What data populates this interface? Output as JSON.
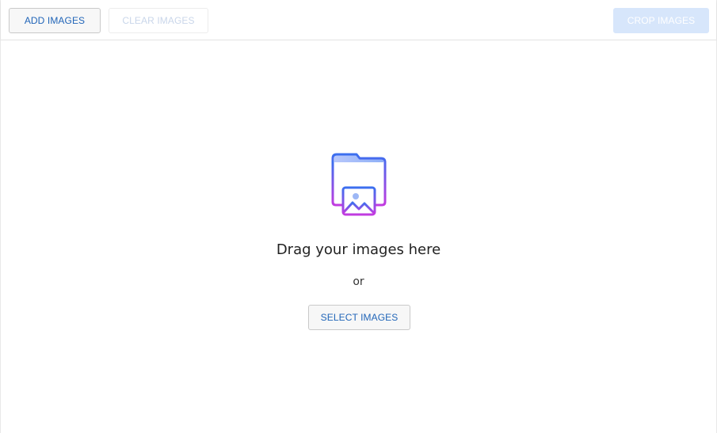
{
  "toolbar": {
    "add_label": "ADD IMAGES",
    "clear_label": "CLEAR IMAGES",
    "crop_label": "CROP IMAGES"
  },
  "dropzone": {
    "icon": "folder-image-icon",
    "drag_text": "Drag your images here",
    "or_text": "or",
    "select_label": "SELECT IMAGES"
  },
  "colors": {
    "accent_blue": "#2165b8",
    "disabled_text": "#c9d6ea",
    "crop_bg": "#d7e6fb",
    "icon_gradient_start": "#3b6fef",
    "icon_gradient_end": "#c23be0"
  }
}
